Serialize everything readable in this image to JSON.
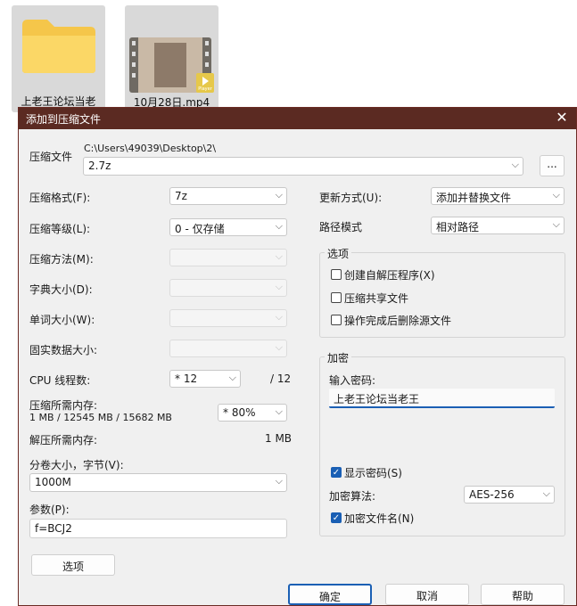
{
  "desktop": {
    "folder": {
      "label": "上老王论坛当老"
    },
    "video": {
      "label": "10月28日.mp4",
      "badge": "Player"
    }
  },
  "dialog": {
    "title": "添加到压缩文件",
    "archive": {
      "label": "压缩文件",
      "path": "C:\\Users\\49039\\Desktop\\2\\",
      "name": "2.7z",
      "browse": "..."
    },
    "format": {
      "label": "压缩格式(F):",
      "value": "7z"
    },
    "level": {
      "label": "压缩等级(L):",
      "value": "0 - 仅存储"
    },
    "method": {
      "label": "压缩方法(M):",
      "value": ""
    },
    "dict": {
      "label": "字典大小(D):",
      "value": ""
    },
    "word": {
      "label": "单词大小(W):",
      "value": ""
    },
    "solid": {
      "label": "固实数据大小:",
      "value": ""
    },
    "threads": {
      "label": "CPU 线程数:",
      "value": "* 12",
      "max": "/ 12"
    },
    "mem": {
      "label": "压缩所需内存:",
      "detail": "1 MB / 12545 MB / 15682 MB",
      "value": "* 80%"
    },
    "decomp": {
      "label": "解压所需内存:",
      "value": "1 MB"
    },
    "volume": {
      "label": "分卷大小，字节(V):",
      "value": "1000M"
    },
    "params": {
      "label": "参数(P):",
      "value": "f=BCJ2"
    },
    "options_button": "选项",
    "update": {
      "label": "更新方式(U):",
      "value": "添加并替换文件"
    },
    "pathmode": {
      "label": "路径模式",
      "value": "相对路径"
    },
    "options_group": {
      "title": "选项",
      "sfx": "创建自解压程序(X)",
      "shared": "压缩共享文件",
      "delete": "操作完成后删除源文件"
    },
    "encryption": {
      "title": "加密",
      "pw_label": "输入密码:",
      "password": "上老王论坛当老王",
      "show_pw": "显示密码(S)",
      "method_label": "加密算法:",
      "method": "AES-256",
      "encrypt_names": "加密文件名(N)"
    },
    "buttons": {
      "ok": "确定",
      "cancel": "取消",
      "help": "帮助"
    }
  }
}
